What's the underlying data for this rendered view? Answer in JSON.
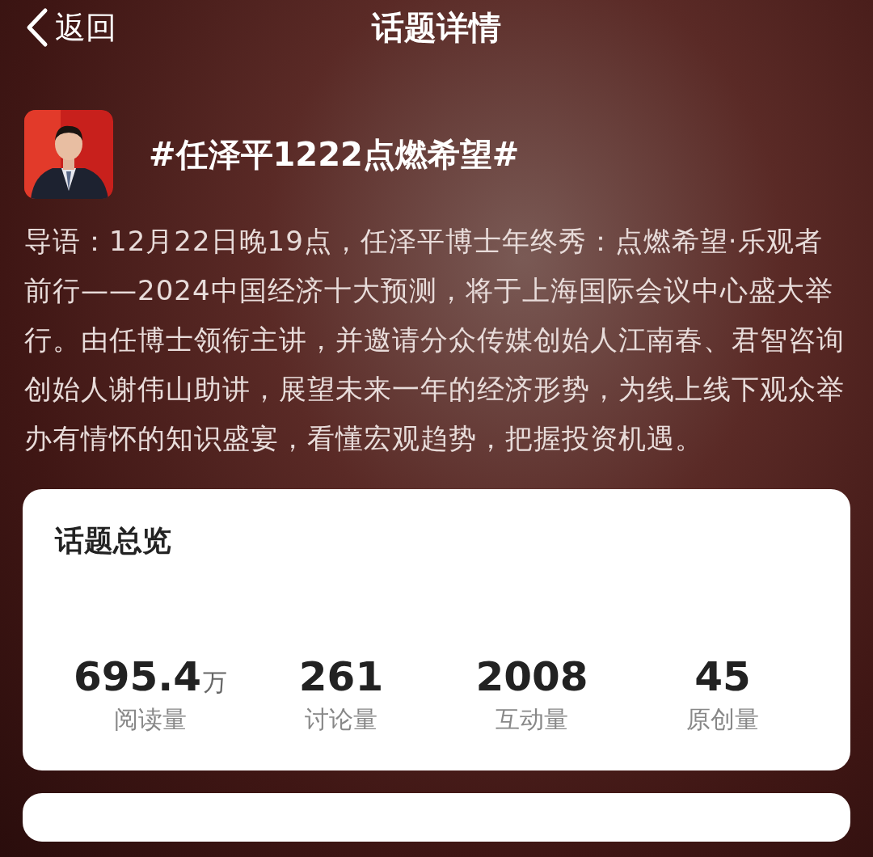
{
  "nav": {
    "back": "返回",
    "title": "话题详情"
  },
  "topic": {
    "title": "#任泽平1222点燃希望#",
    "intro": "导语：12月22日晚19点，任泽平博士年终秀：点燃希望·乐观者前行——2024中国经济十大预测，将于上海国际会议中心盛大举行。由任博士领衔主讲，并邀请分众传媒创始人江南春、君智咨询创始人谢伟山助讲，展望未来一年的经济形势，为线上线下观众举办有情怀的知识盛宴，看懂宏观趋势，把握投资机遇。"
  },
  "overview": {
    "title": "话题总览",
    "stats": [
      {
        "value": "695.4",
        "unit": "万",
        "label": "阅读量"
      },
      {
        "value": "261",
        "label": "讨论量"
      },
      {
        "value": "2008",
        "label": "互动量"
      },
      {
        "value": "45",
        "label": "原创量"
      }
    ]
  }
}
